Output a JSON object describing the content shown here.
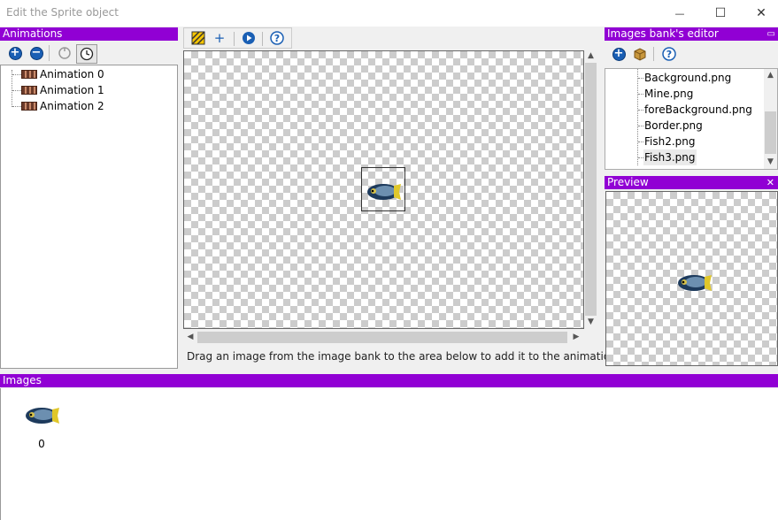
{
  "window": {
    "title": "Edit the Sprite object",
    "minimize": "—",
    "maximize": "☐",
    "close": "✕"
  },
  "animations": {
    "header": "Animations",
    "items": [
      "Animation 0",
      "Animation 1",
      "Animation 2"
    ]
  },
  "canvas": {
    "hint": "Drag an image from the image bank to the area below to add it to the animation."
  },
  "bank": {
    "header": "Images bank's editor",
    "collapse": "▭",
    "files": [
      "Background.png",
      "Mine.png",
      "foreBackground.png",
      "Border.png",
      "Fish2.png",
      "Fish3.png"
    ],
    "selected_index": 5
  },
  "preview": {
    "header": "Preview",
    "close": "✕"
  },
  "images": {
    "header": "Images",
    "frames": [
      {
        "index": "0"
      }
    ]
  },
  "colors": {
    "header_bg": "#9100d4",
    "icon_blue": "#1a5fb4"
  },
  "icons": {
    "anim_toolbar": [
      "add-icon",
      "remove-icon",
      "loop-icon",
      "timer-icon"
    ],
    "canvas_toolbar": [
      "transparency-icon",
      "crosshair-icon",
      "play-icon",
      "help-icon"
    ],
    "bank_toolbar": [
      "add-icon",
      "package-icon",
      "help-icon"
    ]
  }
}
